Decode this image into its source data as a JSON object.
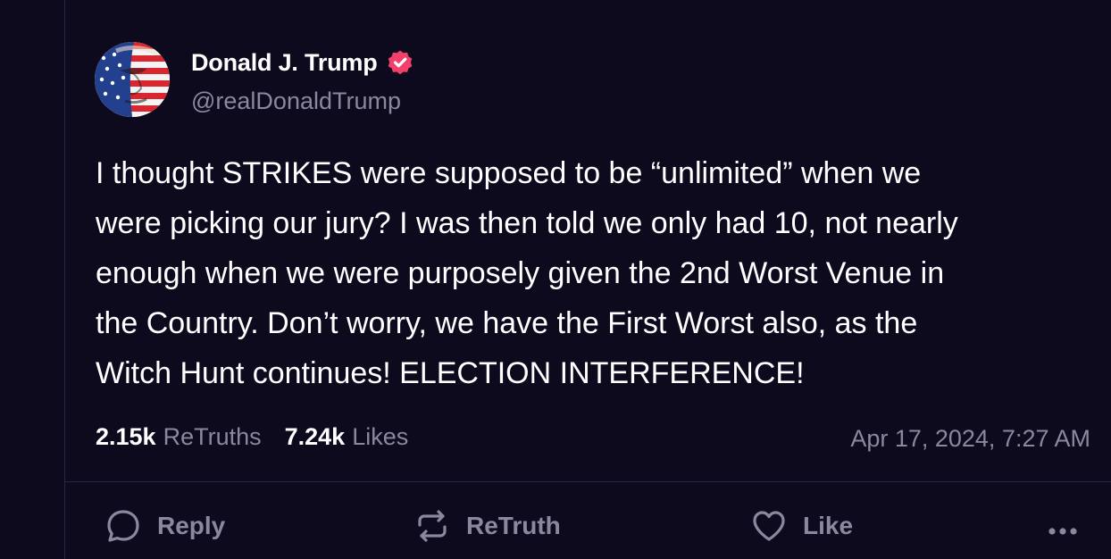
{
  "author": {
    "display_name": "Donald J. Trump",
    "handle": "@realDonaldTrump",
    "verified": true,
    "verified_color": "#f2406a"
  },
  "post": {
    "text": "I thought STRIKES were supposed to be “unlimited” when we\nwere  picking our jury? I was then told we only had 10, not nearly\nenough when we were purposely given the 2nd Worst Venue in\nthe Country. Don’t worry, we have the First Worst also, as the\nWitch Hunt continues! ELECTION INTERFERENCE!",
    "retruths_count": "2.15k",
    "retruths_label": "ReTruths",
    "likes_count": "7.24k",
    "likes_label": "Likes",
    "timestamp": "Apr 17, 2024, 7:27 AM"
  },
  "actions": {
    "reply_label": "Reply",
    "retruth_label": "ReTruth",
    "like_label": "Like",
    "reply_icon": "reply-bubble-icon",
    "retruth_icon": "retruth-arrows-icon",
    "like_icon": "heart-icon",
    "more_icon": "more-dots-icon"
  },
  "colors": {
    "background": "#0d0a1e",
    "primary_text": "#ffffff",
    "secondary_text": "#8a879e",
    "divider": "#2a2545"
  }
}
